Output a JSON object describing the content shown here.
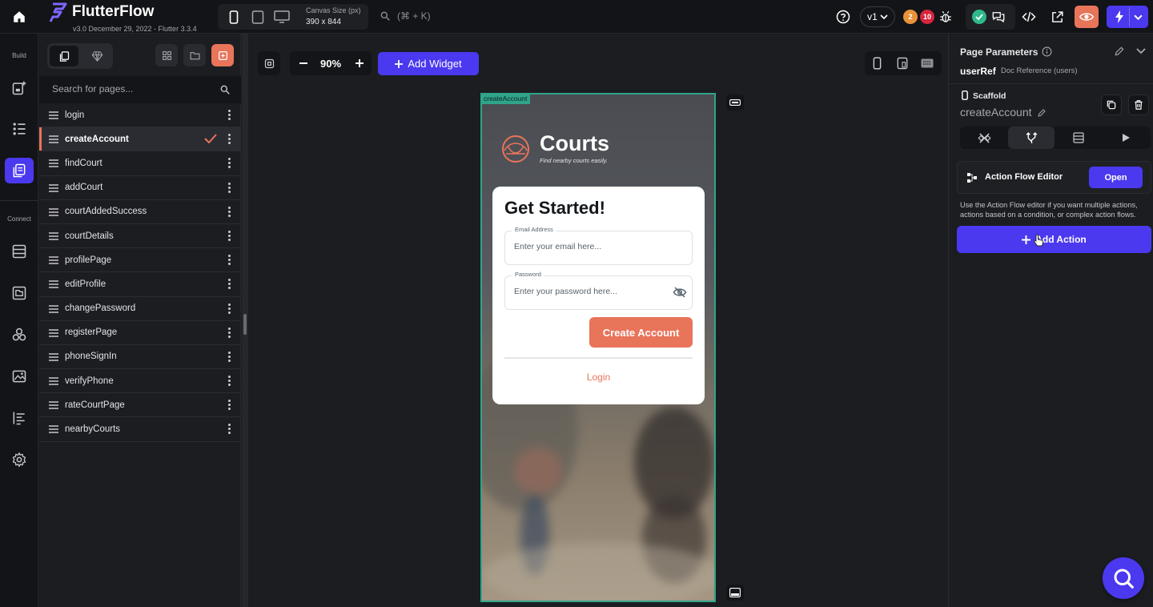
{
  "app": {
    "name": "FlutterFlow",
    "version": "v3.0 December 29, 2022 - Flutter 3.3.4"
  },
  "topbar": {
    "canvas_size_label": "Canvas Size (px)",
    "canvas_size_value": "390 x 844",
    "search_shortcut": "(⌘ + K)",
    "version_branch": "v1",
    "warning_count": "2",
    "error_count": "10"
  },
  "rail": {
    "build_label": "Build",
    "connect_label": "Connect"
  },
  "pages_panel": {
    "search_placeholder": "Search for pages...",
    "pages": [
      {
        "name": "login"
      },
      {
        "name": "createAccount",
        "selected": true
      },
      {
        "name": "findCourt"
      },
      {
        "name": "addCourt"
      },
      {
        "name": "courtAddedSuccess"
      },
      {
        "name": "courtDetails"
      },
      {
        "name": "profilePage"
      },
      {
        "name": "editProfile"
      },
      {
        "name": "changePassword"
      },
      {
        "name": "registerPage"
      },
      {
        "name": "phoneSignIn"
      },
      {
        "name": "verifyPhone"
      },
      {
        "name": "rateCourtPage"
      },
      {
        "name": "nearbyCourts"
      }
    ]
  },
  "canvas": {
    "zoom": "90%",
    "add_widget_label": "Add Widget",
    "page_tag": "createAccount"
  },
  "phone": {
    "brand_name": "Courts",
    "brand_tagline": "Find nearby courts easily.",
    "card_title": "Get Started!",
    "email_label": "Email Address",
    "email_placeholder": "Enter your email here...",
    "password_label": "Password",
    "password_placeholder": "Enter your password here...",
    "create_button": "Create Account",
    "login_link": "Login"
  },
  "props_panel": {
    "title": "Page Parameters",
    "param_name": "userRef",
    "param_type": "Doc Reference (users)",
    "widget_type": "Scaffold",
    "widget_name": "createAccount",
    "action_flow_label": "Action Flow Editor",
    "open_label": "Open",
    "help_text": "Use the Action Flow editor if you want multiple actions, actions based on a condition, or complex action flows.",
    "add_action_label": "Add Action"
  },
  "colors": {
    "accent": "#4b39ef",
    "brand_orange": "#e8745a",
    "selection_green": "#2fa489"
  }
}
